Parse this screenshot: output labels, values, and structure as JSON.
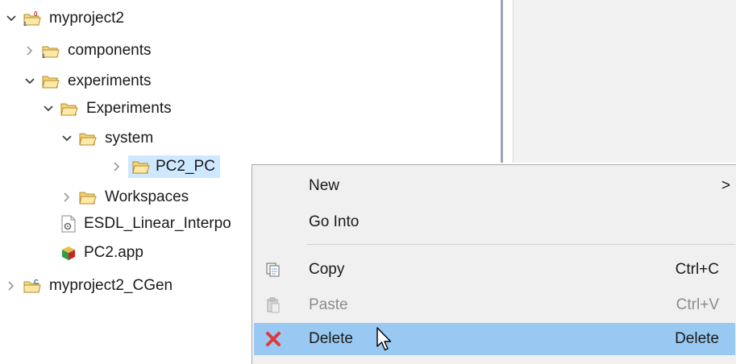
{
  "tree": {
    "items": [
      {
        "label": "myproject2",
        "icon": "project-folder-icon",
        "toggle": "expanded"
      },
      {
        "label": "components",
        "icon": "package-folder-icon",
        "toggle": "collapsed"
      },
      {
        "label": "experiments",
        "icon": "folder-icon",
        "toggle": "expanded"
      },
      {
        "label": "Experiments",
        "icon": "folder-icon",
        "toggle": "expanded"
      },
      {
        "label": "system",
        "icon": "folder-icon",
        "toggle": "expanded"
      },
      {
        "label": "PC2_PC",
        "icon": "folder-icon",
        "toggle": "collapsed",
        "selected": true
      },
      {
        "label": "Workspaces",
        "icon": "folder-icon",
        "toggle": "collapsed"
      },
      {
        "label": "ESDL_Linear_Interpo",
        "icon": "gear-file-icon",
        "toggle": "none"
      },
      {
        "label": "PC2.app",
        "icon": "app-cube-icon",
        "toggle": "none"
      },
      {
        "label": "myproject2_CGen",
        "icon": "c-project-folder-icon",
        "toggle": "collapsed"
      }
    ]
  },
  "context_menu": {
    "items": [
      {
        "label": "New",
        "shortcut": "",
        "submenu": true
      },
      {
        "label": "Go Into",
        "shortcut": ""
      },
      {
        "label": "Copy",
        "shortcut": "Ctrl+C",
        "icon": "copy-icon"
      },
      {
        "label": "Paste",
        "shortcut": "Ctrl+V",
        "icon": "paste-icon",
        "disabled": true
      },
      {
        "label": "Delete",
        "shortcut": "Delete",
        "icon": "delete-icon",
        "highlighted": true
      }
    ],
    "submenu_arrow": ">"
  },
  "colors": {
    "selection": "#cde8ff",
    "menu_highlight": "#99c9f2",
    "menu_background": "#f0f0f0",
    "folder": "#f5d37a",
    "delete_red": "#e0393a"
  }
}
